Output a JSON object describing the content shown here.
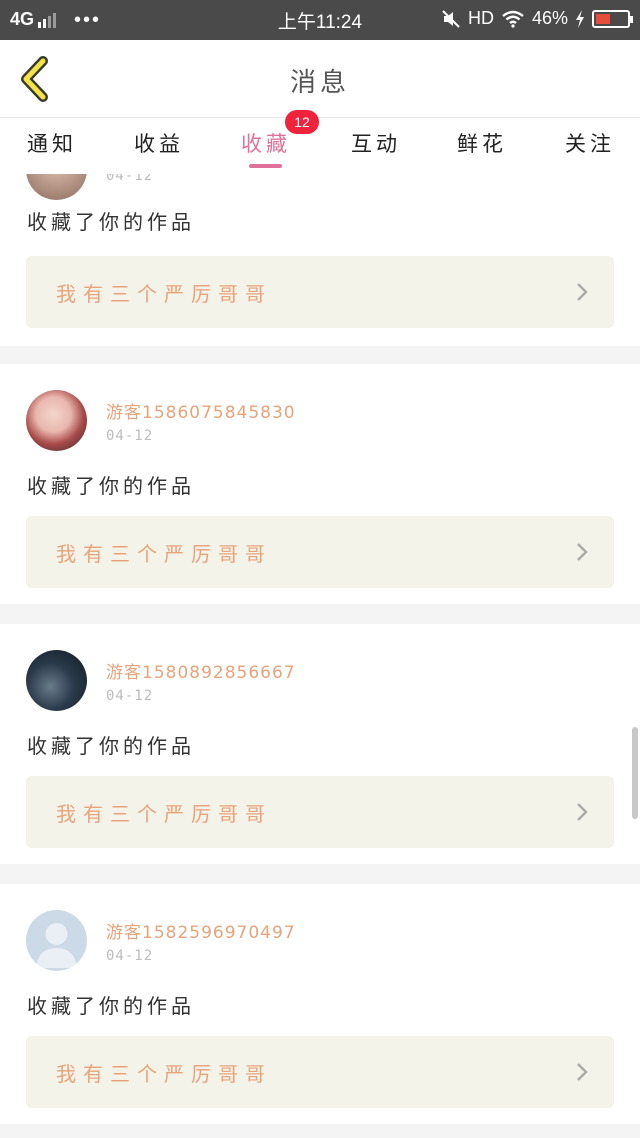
{
  "status_bar": {
    "network": "4G",
    "dots": "•••",
    "time": "上午11:24",
    "hd": "HD",
    "battery": "46%"
  },
  "header": {
    "title": "消息"
  },
  "tabs": [
    {
      "label": "通知"
    },
    {
      "label": "收益"
    },
    {
      "label": "收藏"
    },
    {
      "label": "互动"
    },
    {
      "label": "鲜花"
    },
    {
      "label": "关注"
    }
  ],
  "active_tab": "收藏",
  "badge_count": "12",
  "colors": {
    "accent": "#e0729a",
    "badge": "#f0233c",
    "username": "#e8a37a",
    "work_bg": "#f3f3ea"
  },
  "cards": [
    {
      "user": "",
      "date": "04-12",
      "action": "收藏了你的作品",
      "work": "我有三个严厉哥哥"
    },
    {
      "user": "游客1586075845830",
      "date": "04-12",
      "action": "收藏了你的作品",
      "work": "我有三个严厉哥哥"
    },
    {
      "user": "游客1580892856667",
      "date": "04-12",
      "action": "收藏了你的作品",
      "work": "我有三个严厉哥哥"
    },
    {
      "user": "游客1582596970497",
      "date": "04-12",
      "action": "收藏了你的作品",
      "work": "我有三个严厉哥哥"
    }
  ]
}
